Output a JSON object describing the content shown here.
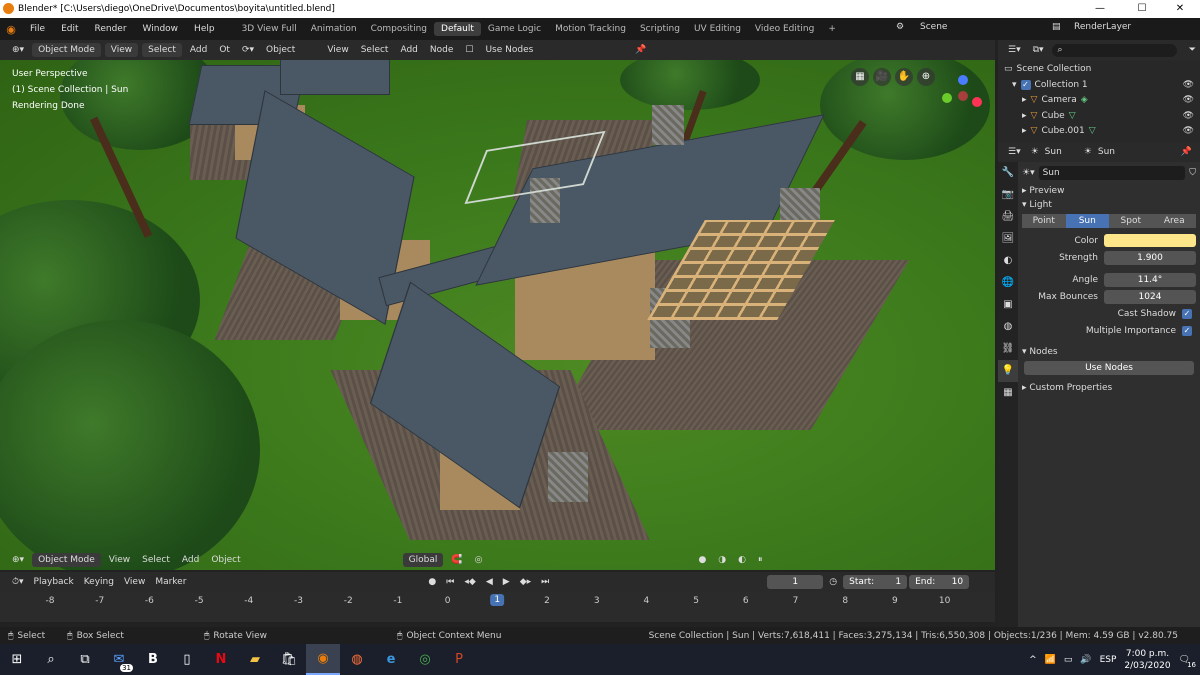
{
  "window": {
    "title": "Blender* [C:\\Users\\diego\\OneDrive\\Documentos\\boyita\\untitled.blend]",
    "minimize": "—",
    "maximize": "☐",
    "close": "✕"
  },
  "menubar": {
    "items": [
      "File",
      "Edit",
      "Render",
      "Window",
      "Help"
    ],
    "workspaces": [
      "3D View Full",
      "Animation",
      "Compositing",
      "Default",
      "Game Logic",
      "Motion Tracking",
      "Scripting",
      "UV Editing",
      "Video Editing"
    ],
    "active_workspace": "Default",
    "scene": "Scene",
    "render_layer": "RenderLayer"
  },
  "viewport_header": {
    "mode": "Object Mode",
    "menus": [
      "View",
      "Select",
      "Add",
      "Ot"
    ],
    "orientation": "Object",
    "menus2": [
      "View",
      "Select",
      "Add",
      "Node"
    ],
    "use_nodes": "Use Nodes"
  },
  "viewport": {
    "info_lines": [
      "User Perspective",
      "(1) Scene Collection | Sun",
      "Rendering Done"
    ],
    "footer_mode": "Object Mode",
    "footer_menus": [
      "View",
      "Select",
      "Add",
      "Object"
    ],
    "transform": "Global"
  },
  "timeline": {
    "menus": [
      "Playback",
      "Keying",
      "View",
      "Marker"
    ],
    "current_frame": "1",
    "start_label": "Start:",
    "start": "1",
    "end_label": "End:",
    "end": "10",
    "ticks": [
      "-8",
      "-7",
      "-6",
      "-5",
      "-4",
      "-3",
      "-2",
      "-1",
      "0",
      "1",
      "2",
      "3",
      "4",
      "5",
      "6",
      "7",
      "8",
      "9",
      "10"
    ]
  },
  "statusbar": {
    "select": "Select",
    "box_select": "Box Select",
    "rotate": "Rotate View",
    "context": "Object Context Menu",
    "stats": "Scene Collection | Sun | Verts:7,618,411 | Faces:3,275,134 | Tris:6,550,308 | Objects:1/236 | Mem: 4.59 GB | v2.80.75"
  },
  "taskbar": {
    "time": "7:00 p.m.",
    "date": "2/03/2020",
    "lang": "ESP",
    "mail_badge": "31",
    "notif_count": "16"
  },
  "outliner": {
    "root": "Scene Collection",
    "collection": "Collection 1",
    "items": [
      "Camera",
      "Cube",
      "Cube.001"
    ]
  },
  "properties": {
    "object": "Sun",
    "data": "Sun",
    "datablock": "Sun",
    "preview": "Preview",
    "light": "Light",
    "types": [
      "Point",
      "Sun",
      "Spot",
      "Area"
    ],
    "active_type": "Sun",
    "color_label": "Color",
    "color": "#fde58a",
    "strength_label": "Strength",
    "strength": "1.900",
    "angle_label": "Angle",
    "angle": "11.4°",
    "bounces_label": "Max Bounces",
    "bounces": "1024",
    "cast_shadow": "Cast Shadow",
    "multiple_importance": "Multiple Importance",
    "nodes": "Nodes",
    "use_nodes": "Use Nodes",
    "custom_props": "Custom Properties"
  }
}
